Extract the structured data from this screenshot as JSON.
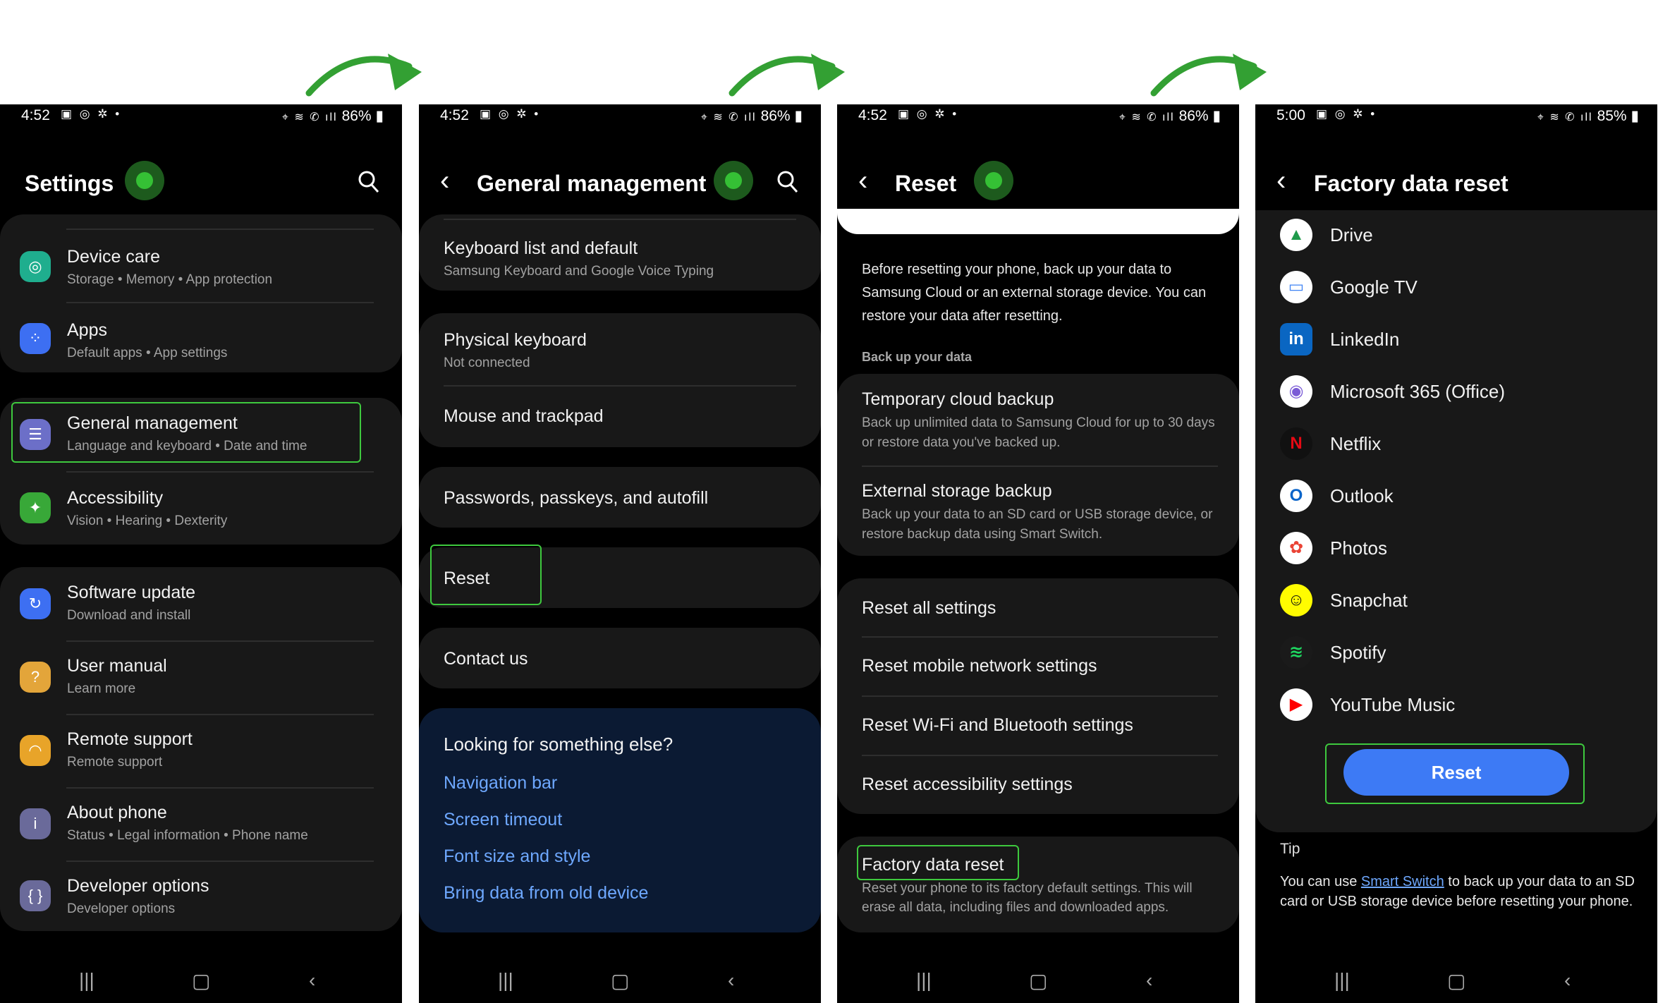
{
  "colors": {
    "highlight": "#3ec93e",
    "accent_button": "#3d7af5",
    "link": "#6ea8ff",
    "background": "#000000",
    "card": "#181818"
  },
  "screens": [
    {
      "status": {
        "time": "4:52",
        "battery": "86%"
      },
      "title": "Settings",
      "items": [
        {
          "title": "Device care",
          "subtitle": "Storage  •  Memory  •  App protection",
          "icon": "device-care-icon"
        },
        {
          "title": "Apps",
          "subtitle": "Default apps  •  App settings",
          "icon": "apps-icon"
        },
        {
          "title": "General management",
          "subtitle": "Language and keyboard  •  Date and time",
          "icon": "sliders-icon"
        },
        {
          "title": "Accessibility",
          "subtitle": "Vision  •  Hearing  •  Dexterity",
          "icon": "accessibility-icon"
        },
        {
          "title": "Software update",
          "subtitle": "Download and install",
          "icon": "update-icon"
        },
        {
          "title": "User manual",
          "subtitle": "Learn more",
          "icon": "manual-icon"
        },
        {
          "title": "Remote support",
          "subtitle": "Remote support",
          "icon": "headset-icon"
        },
        {
          "title": "About phone",
          "subtitle": "Status  •  Legal information  •  Phone name",
          "icon": "info-icon"
        },
        {
          "title": "Developer options",
          "subtitle": "Developer options",
          "icon": "braces-icon"
        }
      ]
    },
    {
      "status": {
        "time": "4:52",
        "battery": "86%"
      },
      "title": "General management",
      "items": [
        {
          "title": "Keyboard list and default",
          "subtitle": "Samsung Keyboard and Google Voice Typing"
        },
        {
          "title": "Physical keyboard",
          "subtitle": "Not connected"
        },
        {
          "title": "Mouse and trackpad"
        },
        {
          "title": "Passwords, passkeys, and autofill"
        },
        {
          "title": "Reset"
        },
        {
          "title": "Contact us"
        }
      ],
      "suggest": {
        "heading": "Looking for something else?",
        "links": [
          "Navigation bar",
          "Screen timeout",
          "Font size and style",
          "Bring data from old device"
        ]
      }
    },
    {
      "status": {
        "time": "4:52",
        "battery": "86%"
      },
      "title": "Reset",
      "intro": "Before resetting your phone, back up your data to Samsung Cloud or an external storage device. You can restore your data after resetting.",
      "section": "Back up your data",
      "backup": [
        {
          "title": "Temporary cloud backup",
          "subtitle": "Back up unlimited data to Samsung Cloud for up to 30 days or restore data you've backed up."
        },
        {
          "title": "External storage backup",
          "subtitle": "Back up your data to an SD card or USB storage device, or restore backup data using Smart Switch."
        }
      ],
      "resets": [
        "Reset all settings",
        "Reset mobile network settings",
        "Reset Wi-Fi and Bluetooth settings",
        "Reset accessibility settings"
      ],
      "factory": {
        "title": "Factory data reset",
        "subtitle": "Reset your phone to its factory default settings. This will erase all data, including files and downloaded apps."
      }
    },
    {
      "status": {
        "time": "5:00",
        "battery": "85%"
      },
      "title": "Factory data reset",
      "apps": [
        "Drive",
        "Google TV",
        "LinkedIn",
        "Microsoft 365 (Office)",
        "Netflix",
        "Outlook",
        "Photos",
        "Snapchat",
        "Spotify",
        "YouTube Music"
      ],
      "button": "Reset",
      "tip": {
        "heading": "Tip",
        "before": "You can use ",
        "link": "Smart Switch",
        "after": " to back up your data to an SD card or USB storage device before resetting your phone."
      }
    }
  ]
}
